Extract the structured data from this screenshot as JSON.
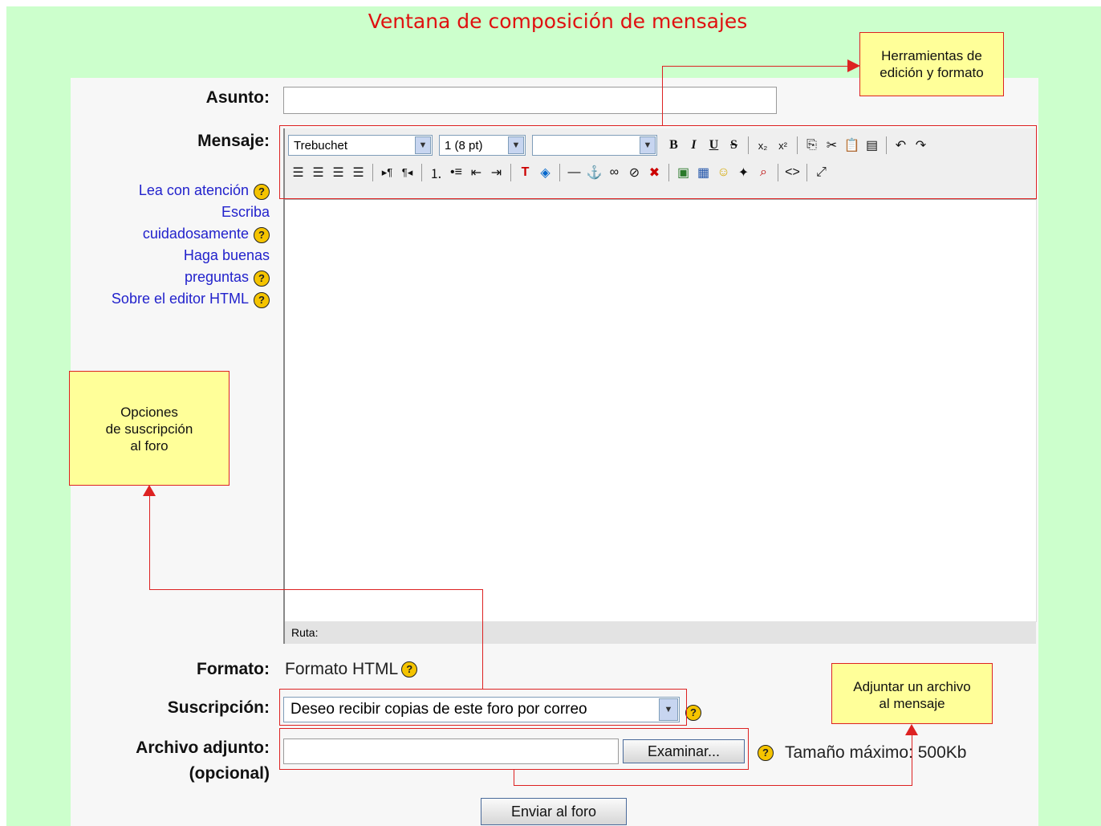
{
  "title": "Ventana de composición de mensajes",
  "form": {
    "subject_label": "Asunto:",
    "subject_value": "",
    "message_label": "Mensaje:",
    "format_label": "Formato:",
    "format_value": "Formato HTML",
    "subscription_label": "Suscripción:",
    "subscription_value": "Deseo recibir copias de este foro por correo",
    "attachment_label": "Archivo adjunto:",
    "attachment_label2": "(opcional)",
    "browse_button": "Examinar...",
    "max_size": "Tamaño máximo: 500Kb",
    "submit_button": "Enviar al foro"
  },
  "help_links": [
    "Lea con atención",
    "Escriba",
    "cuidadosamente",
    "Haga buenas",
    "preguntas",
    "Sobre el editor HTML"
  ],
  "editor": {
    "font_value": "Trebuchet",
    "size_value": "1 (8 pt)",
    "heading_value": "",
    "path_label": "Ruta:",
    "row1_icons": [
      "bold-icon",
      "italic-icon",
      "underline-icon",
      "strikethrough-icon",
      "subscript-icon",
      "superscript-icon",
      "copy-icon",
      "cut-icon",
      "paste-icon",
      "paste-word-icon",
      "undo-icon",
      "redo-icon"
    ],
    "row2_icons": [
      "align-left-icon",
      "align-center-icon",
      "align-right-icon",
      "justify-icon",
      "ltr-icon",
      "rtl-icon",
      "ordered-list-icon",
      "unordered-list-icon",
      "outdent-icon",
      "indent-icon",
      "text-color-icon",
      "background-color-icon",
      "horizontal-rule-icon",
      "anchor-icon",
      "link-icon",
      "unlink-icon",
      "no-link-icon",
      "image-icon",
      "table-icon",
      "smiley-icon",
      "special-char-icon",
      "search-replace-icon",
      "html-source-icon",
      "fullscreen-icon"
    ]
  },
  "callouts": {
    "tools": "Herramientas de\nedición y formato",
    "subscription": "Opciones\nde suscripción\nal foro",
    "attach": "Adjuntar un archivo\nal mensaje"
  },
  "colors": {
    "background": "#ccffcc",
    "accent": "#e01010",
    "callout": "#ffff99",
    "link": "#2222cc"
  }
}
